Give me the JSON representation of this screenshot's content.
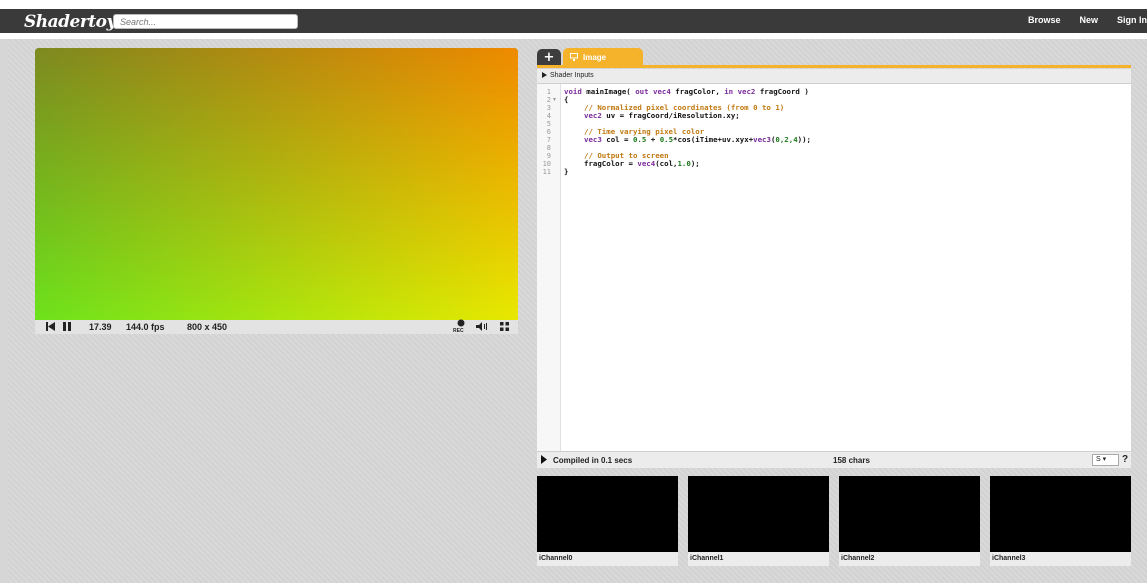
{
  "nav": {
    "logo": "Shadertoy",
    "search_placeholder": "Search...",
    "links": [
      "Browse",
      "New",
      "Sign In"
    ]
  },
  "player": {
    "time": "17.39",
    "fps": "144.0 fps",
    "resolution": "800 x 450",
    "rec_label": "REC",
    "icons": [
      "rewind-icon",
      "pause-icon",
      "record-icon",
      "volume-icon",
      "fullscreen-icon"
    ]
  },
  "editor": {
    "tab_add": "+",
    "tab_image": "Image",
    "shader_inputs": "Shader Inputs",
    "line_numbers": [
      "1",
      "2",
      "3",
      "4",
      "5",
      "6",
      "7",
      "8",
      "9",
      "10",
      "11"
    ],
    "compiled": "Compiled in 0.1 secs",
    "chars": "158 chars",
    "lang_select": "S",
    "help": "?"
  },
  "code": {
    "l1_kw1": "void",
    "l1_fn": " mainImage( ",
    "l1_kw2": "out vec4",
    "l1_mid": " fragColor, ",
    "l1_kw3": "in vec2",
    "l1_end": " fragCoord )",
    "l2": "{",
    "l3_comment": "// Normalized pixel coordinates (from 0 to 1)",
    "l4_kw": "vec2",
    "l4_rest": " uv = fragCoord/iResolution.xy;",
    "l6_comment": "// Time varying pixel color",
    "l7_kw": "vec3",
    "l7_a": " col = ",
    "l7_n1": "0.5",
    "l7_b": " + ",
    "l7_n2": "0.5",
    "l7_c": "*cos(iTime+uv.xyx+",
    "l7_kw2": "vec3",
    "l7_d": "(",
    "l7_n3": "0,2,4",
    "l7_e": "));",
    "l9_comment": "// Output to screen",
    "l10_a": "fragColor = ",
    "l10_kw": "vec4",
    "l10_b": "(col,",
    "l10_n": "1.0",
    "l10_c": ");",
    "l11": "}"
  },
  "channels": [
    "iChannel0",
    "iChannel1",
    "iChannel2",
    "iChannel3"
  ]
}
